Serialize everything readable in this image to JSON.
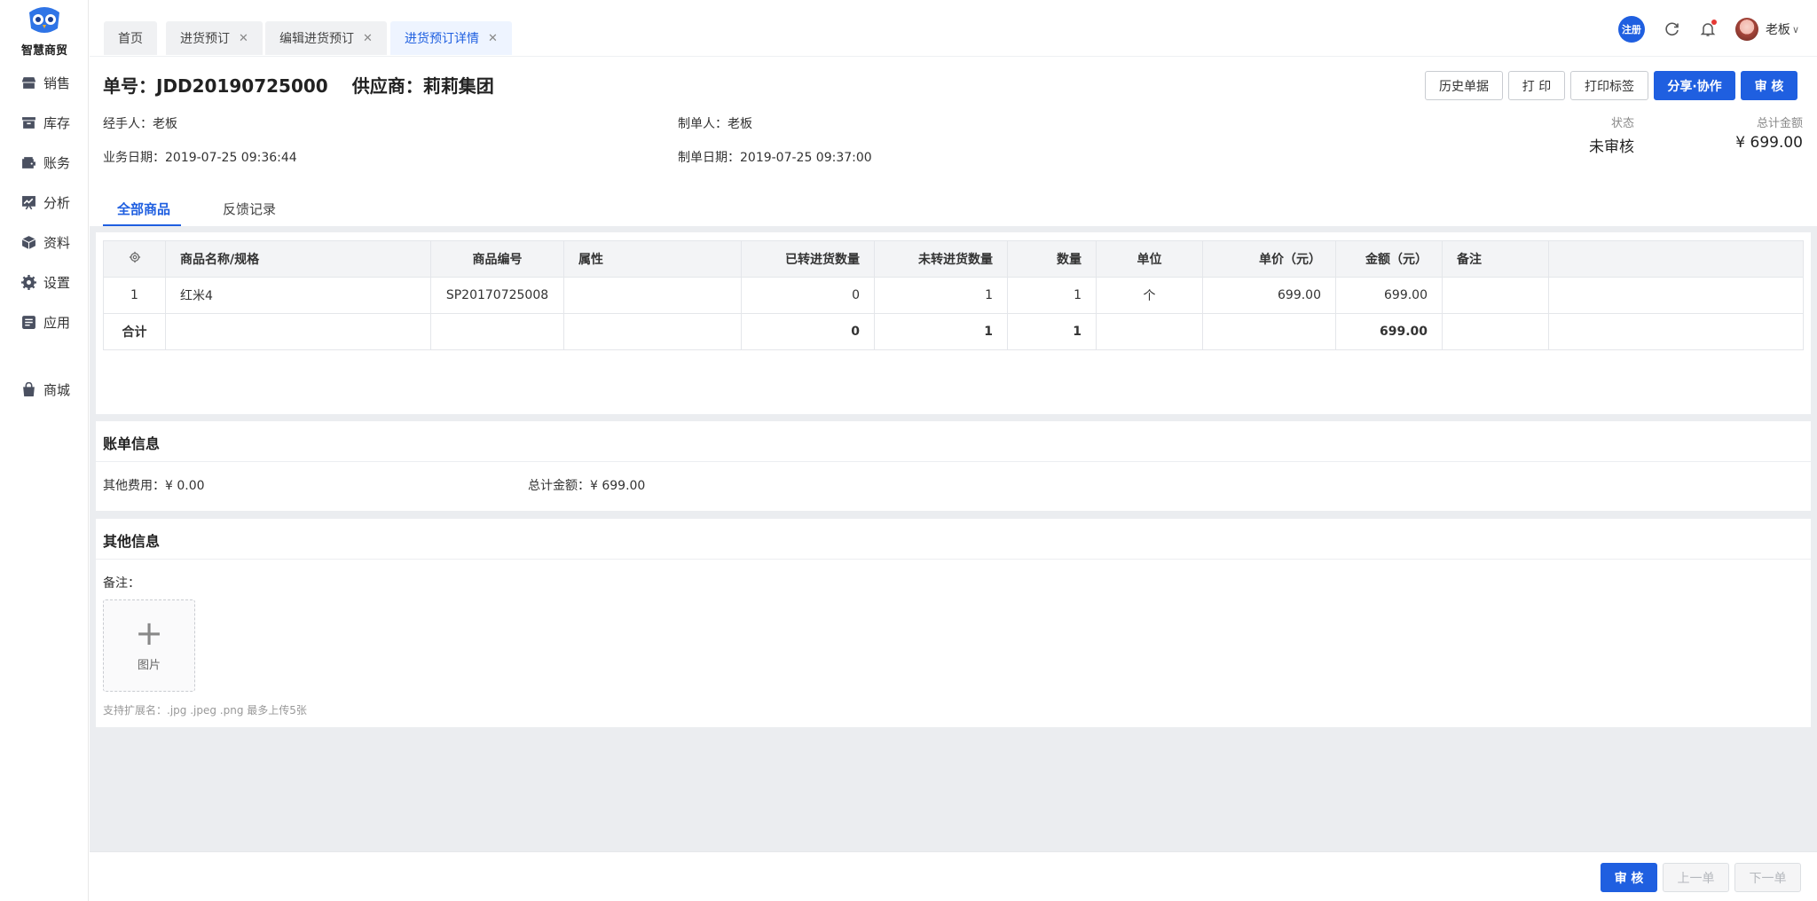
{
  "brand": {
    "name": "智慧商贸"
  },
  "sidebar": {
    "items": [
      {
        "label": "销售",
        "icon": "shop-icon"
      },
      {
        "label": "库存",
        "icon": "box-icon"
      },
      {
        "label": "账务",
        "icon": "wallet-icon"
      },
      {
        "label": "分析",
        "icon": "chart-icon"
      },
      {
        "label": "资料",
        "icon": "cube-icon"
      },
      {
        "label": "设置",
        "icon": "gear-icon"
      },
      {
        "label": "应用",
        "icon": "app-icon"
      },
      {
        "label": "商城",
        "icon": "bag-icon"
      }
    ]
  },
  "tabs": [
    {
      "label": "首页"
    },
    {
      "label": "进货预订"
    },
    {
      "label": "编辑进货预订"
    },
    {
      "label": "进货预订详情"
    }
  ],
  "topbar": {
    "register_label": "注册",
    "user_name": "老板"
  },
  "order": {
    "number": "单号：JDD20190725000",
    "supplier": "供应商：莉莉集团",
    "handler": "经手人：老板",
    "creator": "制单人：老板",
    "business_date": "业务日期：2019-07-25 09:36:44",
    "create_date": "制单日期：2019-07-25 09:37:00",
    "status_label": "状态",
    "status_value": "未审核",
    "total_label": "总计金额",
    "total_value": "¥ 699.00"
  },
  "actions": {
    "history": "历史单据",
    "print": "打 印",
    "print_label": "打印标签",
    "share": "分享·协作",
    "approve": "审 核"
  },
  "subtabs": {
    "all_goods": "全部商品",
    "feedback": "反馈记录"
  },
  "table": {
    "headers": [
      "商品名称/规格",
      "商品编号",
      "属性",
      "已转进货数量",
      "未转进货数量",
      "数量",
      "单位",
      "单价（元）",
      "金额（元）",
      "备注"
    ],
    "row": {
      "index": "1",
      "name": "红米4",
      "code": "SP20170725008",
      "attr": "",
      "converted": "0",
      "unconverted": "1",
      "qty": "1",
      "unit": "个",
      "price": "699.00",
      "amount": "699.00",
      "note": ""
    },
    "total": {
      "label": "合计",
      "converted": "0",
      "unconverted": "1",
      "qty": "1",
      "amount": "699.00"
    }
  },
  "billing": {
    "title": "账单信息",
    "other_fee": "其他费用：¥ 0.00",
    "total": "总计金额：¥ 699.00"
  },
  "other": {
    "title": "其他信息",
    "remark_label": "备注：",
    "upload_label": "图片",
    "hint": "支持扩展名：.jpg .jpeg .png 最多上传5张"
  },
  "bottom": {
    "approve": "审 核",
    "prev": "上一单",
    "next": "下一单"
  },
  "colors": {
    "primary": "#1f5fe0",
    "bg": "#ebedf0"
  }
}
